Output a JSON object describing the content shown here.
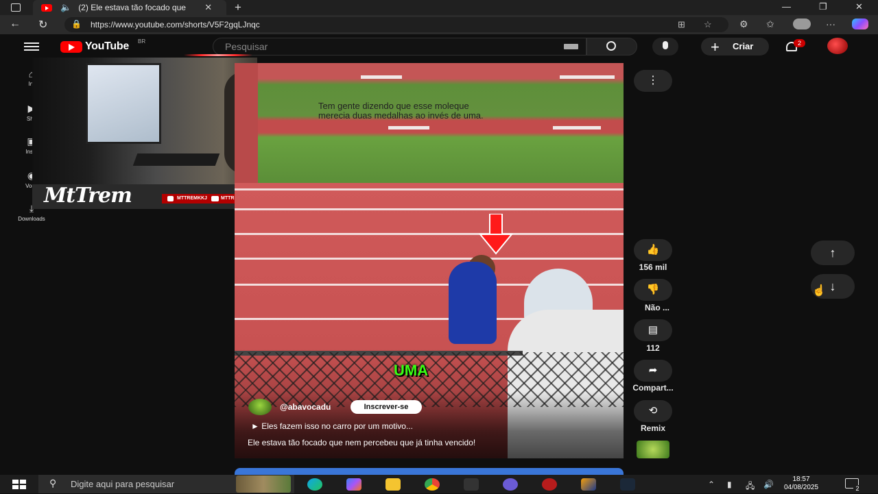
{
  "browser": {
    "tab_title": "(2) Ele estava tão focado que",
    "url": "https://www.youtube.com/shorts/V5F2gqLJnqc"
  },
  "youtube": {
    "logo_text": "YouTube",
    "country": "BR",
    "search_placeholder": "Pesquisar",
    "create_label": "Criar",
    "notification_count": "2"
  },
  "left_nav": {
    "items": [
      {
        "label": "Iní",
        "icon": "home-icon"
      },
      {
        "label": "Sho",
        "icon": "shorts-icon"
      },
      {
        "label": "Inscr",
        "icon": "subscriptions-icon"
      },
      {
        "label": "Você",
        "icon": "you-icon"
      },
      {
        "label": "Downloads",
        "icon": "download-icon"
      }
    ]
  },
  "overlay": {
    "brand_name": "MtTrem",
    "social_1": "MTTREMKKJ",
    "social_2": "MTTREM"
  },
  "video": {
    "caption_line1": "Tem gente dizendo que esse moleque",
    "caption_line2": "merecia duas medalhas ao invés de uma.",
    "overlay_word": "UMA",
    "channel": "@abavocadu",
    "subscribe_label": "Inscrever-se",
    "music": "Eles fazem isso no carro por um motivo...",
    "title": "Ele estava tão focado que nem percebeu que já tinha vencido!"
  },
  "actions": {
    "likes": "156 mil",
    "dislike_label": "Não ...",
    "comments": "112",
    "share_label": "Compart...",
    "remix_label": "Remix"
  },
  "taskbar": {
    "search_placeholder": "Digite aqui para pesquisar",
    "time": "18:57",
    "date": "04/08/2025",
    "notif_count": "2"
  },
  "colors": {
    "youtube_red": "#ff0000",
    "background": "#0f0f0f",
    "overlay_text_green": "#39ff14"
  }
}
